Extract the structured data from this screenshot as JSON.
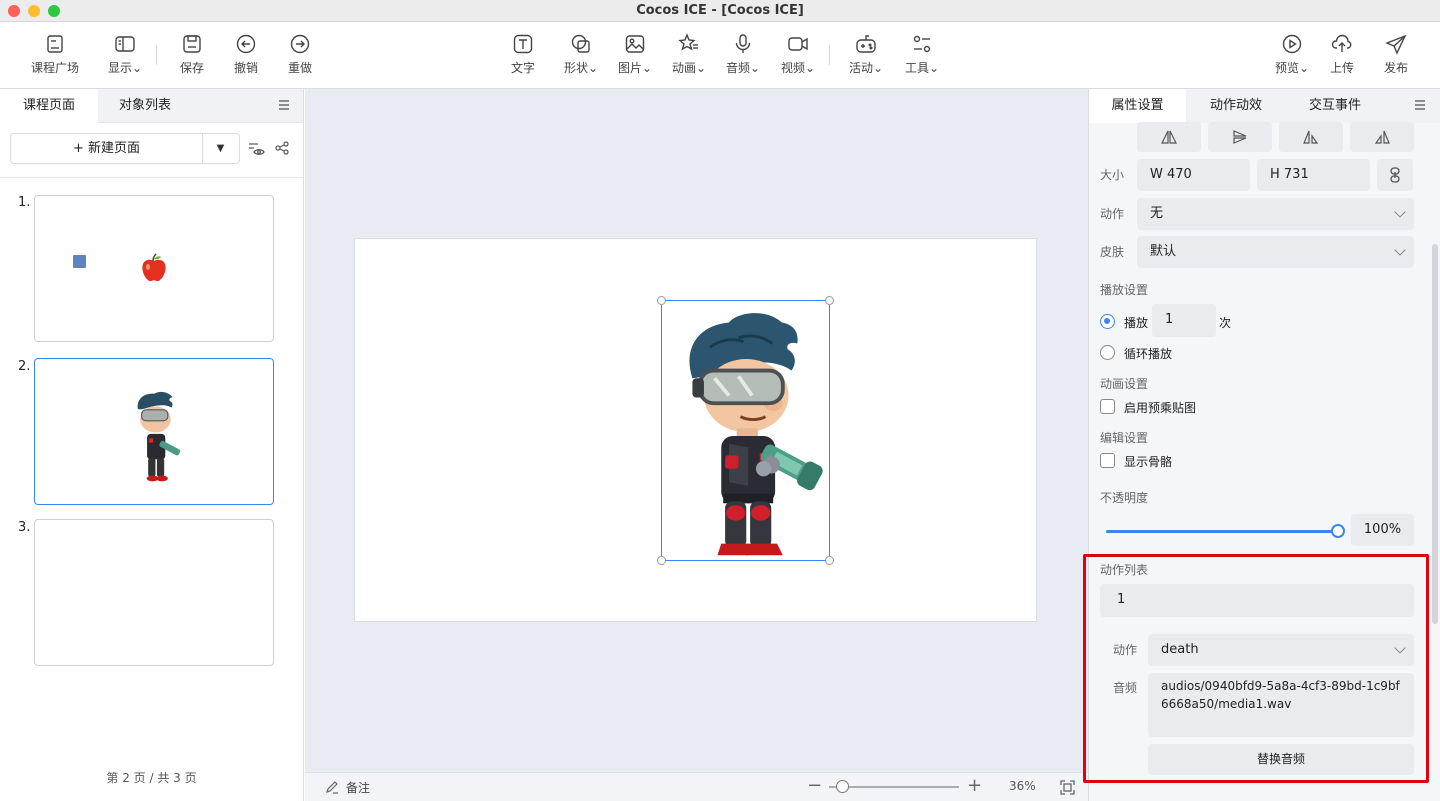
{
  "window": {
    "title": "Cocos ICE - [Cocos ICE]"
  },
  "toolbar": {
    "left": [
      {
        "label": "课程广场",
        "icon": "course-square-icon"
      },
      {
        "label": "显示",
        "icon": "display-icon",
        "dropdown": true
      },
      {
        "label": "保存",
        "icon": "save-icon"
      },
      {
        "label": "撤销",
        "icon": "undo-icon"
      },
      {
        "label": "重做",
        "icon": "redo-icon"
      }
    ],
    "center": [
      {
        "label": "文字",
        "icon": "text-icon"
      },
      {
        "label": "形状",
        "icon": "shape-icon",
        "dropdown": true
      },
      {
        "label": "图片",
        "icon": "image-icon",
        "dropdown": true
      },
      {
        "label": "动画",
        "icon": "animation-icon",
        "dropdown": true
      },
      {
        "label": "音频",
        "icon": "microphone-icon",
        "dropdown": true
      },
      {
        "label": "视频",
        "icon": "video-icon",
        "dropdown": true
      },
      {
        "label": "活动",
        "icon": "gamepad-icon",
        "dropdown": true
      },
      {
        "label": "工具",
        "icon": "tools-icon",
        "dropdown": true
      }
    ],
    "right": [
      {
        "label": "预览",
        "icon": "play-icon",
        "dropdown": true
      },
      {
        "label": "上传",
        "icon": "upload-icon"
      },
      {
        "label": "发布",
        "icon": "send-icon"
      }
    ]
  },
  "left_panel": {
    "tabs": [
      "课程页面",
      "对象列表"
    ],
    "active_tab": 0,
    "new_page_label": "+ 新建页面",
    "pages": [
      {
        "number": "1.",
        "content": "square and apple"
      },
      {
        "number": "2.",
        "content": "character",
        "selected": true
      },
      {
        "number": "3.",
        "content": ""
      }
    ],
    "page_count": "第 2 页 / 共 3 页"
  },
  "status": {
    "notes_label": "备注",
    "zoom_percent": "36%",
    "zoom_level": 0.1
  },
  "right_panel": {
    "tabs": [
      "属性设置",
      "动作动效",
      "交互事件"
    ],
    "active_tab": 0,
    "size_label": "大小",
    "width": "W  470",
    "height": "H  731",
    "action_label": "动作",
    "action_value": "无",
    "skin_label": "皮肤",
    "skin_value": "默认",
    "playback_section": "播放设置",
    "play_label": "播放",
    "play_count": "1",
    "times_label": "次",
    "loop_label": "循环播放",
    "animation_section": "动画设置",
    "premultiply_label": "启用预乘贴图",
    "edit_section": "编辑设置",
    "show_skeleton_label": "显示骨骼",
    "opacity_label": "不透明度",
    "opacity_value": "100%",
    "opacity_level": 1.0,
    "action_list_label": "动作列表",
    "action_list_item": "1",
    "action_item_label": "动作",
    "action_item_value": "death",
    "audio_label": "音频",
    "audio_path": "audios/0940bfd9-5a8a-4cf3-89bd-1c9bf6668a50/media1.wav",
    "replace_audio_button": "替换音频"
  },
  "colors": {
    "accent": "#3a86f0",
    "highlight": "#e0000f"
  }
}
